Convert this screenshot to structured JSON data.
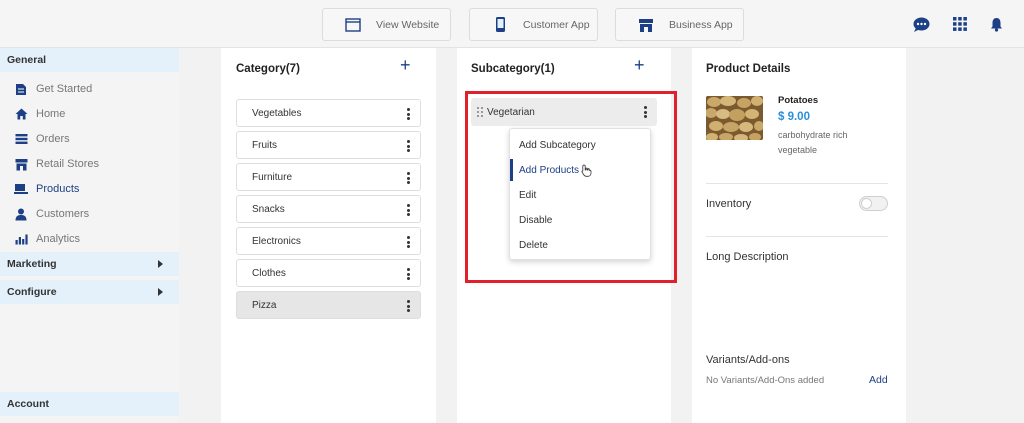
{
  "topbar": {
    "view_website": "View Website",
    "customer_app": "Customer App",
    "business_app": "Business App"
  },
  "sidebar": {
    "general": "General",
    "items": [
      {
        "label": "Get Started",
        "icon": "document-icon"
      },
      {
        "label": "Home",
        "icon": "home-icon"
      },
      {
        "label": "Orders",
        "icon": "orders-icon"
      },
      {
        "label": "Retail Stores",
        "icon": "store-icon"
      },
      {
        "label": "Products",
        "icon": "products-icon"
      },
      {
        "label": "Customers",
        "icon": "user-icon"
      },
      {
        "label": "Analytics",
        "icon": "analytics-icon"
      }
    ],
    "marketing": "Marketing",
    "configure": "Configure",
    "account": "Account"
  },
  "category_panel": {
    "title": "Category(7)",
    "add": "+",
    "items": [
      "Vegetables",
      "Fruits",
      "Furniture",
      "Snacks",
      "Electronics",
      "Clothes",
      "Pizza"
    ],
    "selected": "Pizza"
  },
  "subcategory_panel": {
    "title": "Subcategory(1)",
    "add": "+",
    "item": "Vegetarian",
    "menu": [
      "Add Subcategory",
      "Add Products",
      "Edit",
      "Disable",
      "Delete"
    ],
    "menu_active": "Add Products"
  },
  "product_panel": {
    "title": "Product Details",
    "name": "Potatoes",
    "price": "$ 9.00",
    "description": "carbohydrate rich vegetable",
    "inventory": "Inventory",
    "inventory_on": false,
    "long_description": "Long Description",
    "variants": "Variants/Add-ons",
    "no_variants": "No Variants/Add-Ons added",
    "add": "Add"
  },
  "colors": {
    "accent": "#1d3f86",
    "price": "#2a8fdc",
    "highlight": "#e0202a",
    "section_bg": "#e4f1fb"
  }
}
